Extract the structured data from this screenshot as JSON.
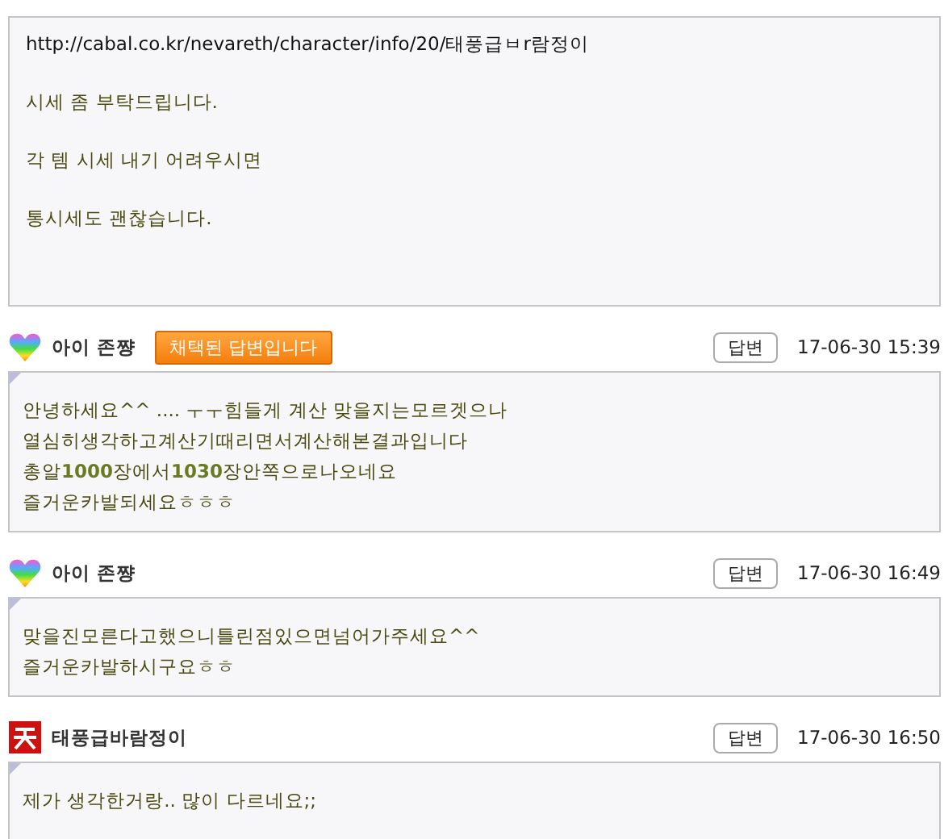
{
  "question": {
    "lines": [
      "http://cabal.co.kr/nevareth/character/info/20/태풍급ㅂr람정이",
      "시세 좀 부탁드립니다.",
      "각 템 시세 내기 어려우시면",
      "통시세도 괜찮습니다."
    ]
  },
  "replies": [
    {
      "kind": "heart",
      "author": "아이 존쨩",
      "badge": "채택된 답변입니다",
      "reply_button": "답변",
      "time": "17-06-30 15:39",
      "lines": [
        "안녕하세요^^ .... ㅜㅜ힘들게 계산 맞을지는모르겟으나",
        "열심히생각하고계산기때리면서계산해본결과입니다",
        "총알**1000**장에서**1030**장안쪽으로나오네요",
        "즐거운카발되세요ㅎㅎㅎ"
      ]
    },
    {
      "kind": "heart",
      "author": "아이 존쨩",
      "reply_button": "답변",
      "time": "17-06-30 16:49",
      "lines": [
        "맞을진모른다고했으니틀린점있으면넘어가주세요^^",
        "즐거운카발하시구요ㅎㅎ"
      ]
    },
    {
      "kind": "red-square",
      "author": "태풍급바람정이",
      "reply_button": "답변",
      "time": "17-06-30 16:50",
      "lines": [
        "제가 생각한거랑.. 많이 다르네요;;"
      ]
    }
  ]
}
